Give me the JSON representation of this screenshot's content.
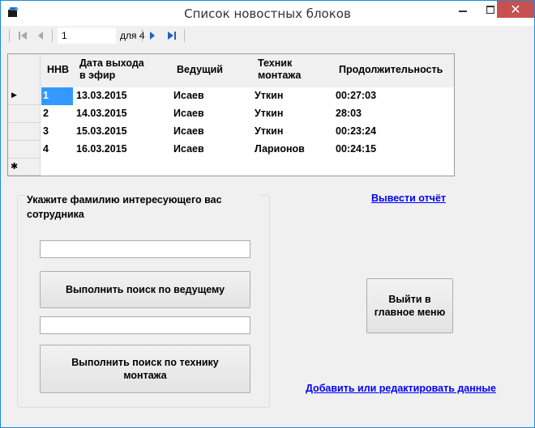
{
  "window": {
    "title": "Список новостных блоков",
    "close_symbol": "✕"
  },
  "navigator": {
    "position": "1",
    "of_label": "для 4"
  },
  "grid": {
    "columns": [
      "ННВ",
      "Дата выхода\nв эфир",
      "Ведущий",
      "Техник\nмонтажа",
      "Продолжительность"
    ],
    "rows": [
      [
        "1",
        "13.03.2015",
        "Исаев",
        "Уткин",
        "00:27:03"
      ],
      [
        "2",
        "14.03.2015",
        "Исаев",
        "Уткин",
        "28:03"
      ],
      [
        "3",
        "15.03.2015",
        "Исаев",
        "Уткин",
        "00:23:24"
      ],
      [
        "4",
        "16.03.2015",
        "Исаев",
        "Ларионов",
        "00:24:15"
      ]
    ],
    "current_row_marker": "▶",
    "new_row_marker": "✱"
  },
  "search": {
    "title": "Укажите фамилию интересующего вас сотрудника",
    "host_value": "",
    "tech_value": "",
    "search_host_label": "Выполнить поиск по ведущему",
    "search_tech_label": "Выполнить поиск по технику\nмонтажа"
  },
  "actions": {
    "report_link": "Вывести отчёт",
    "exit_label": "Выйти в\nглавное меню",
    "edit_link": "Добавить или редактировать данные"
  },
  "colors": {
    "selection": "#3399ff",
    "close_button": "#c75050",
    "link": "#0000ff"
  }
}
